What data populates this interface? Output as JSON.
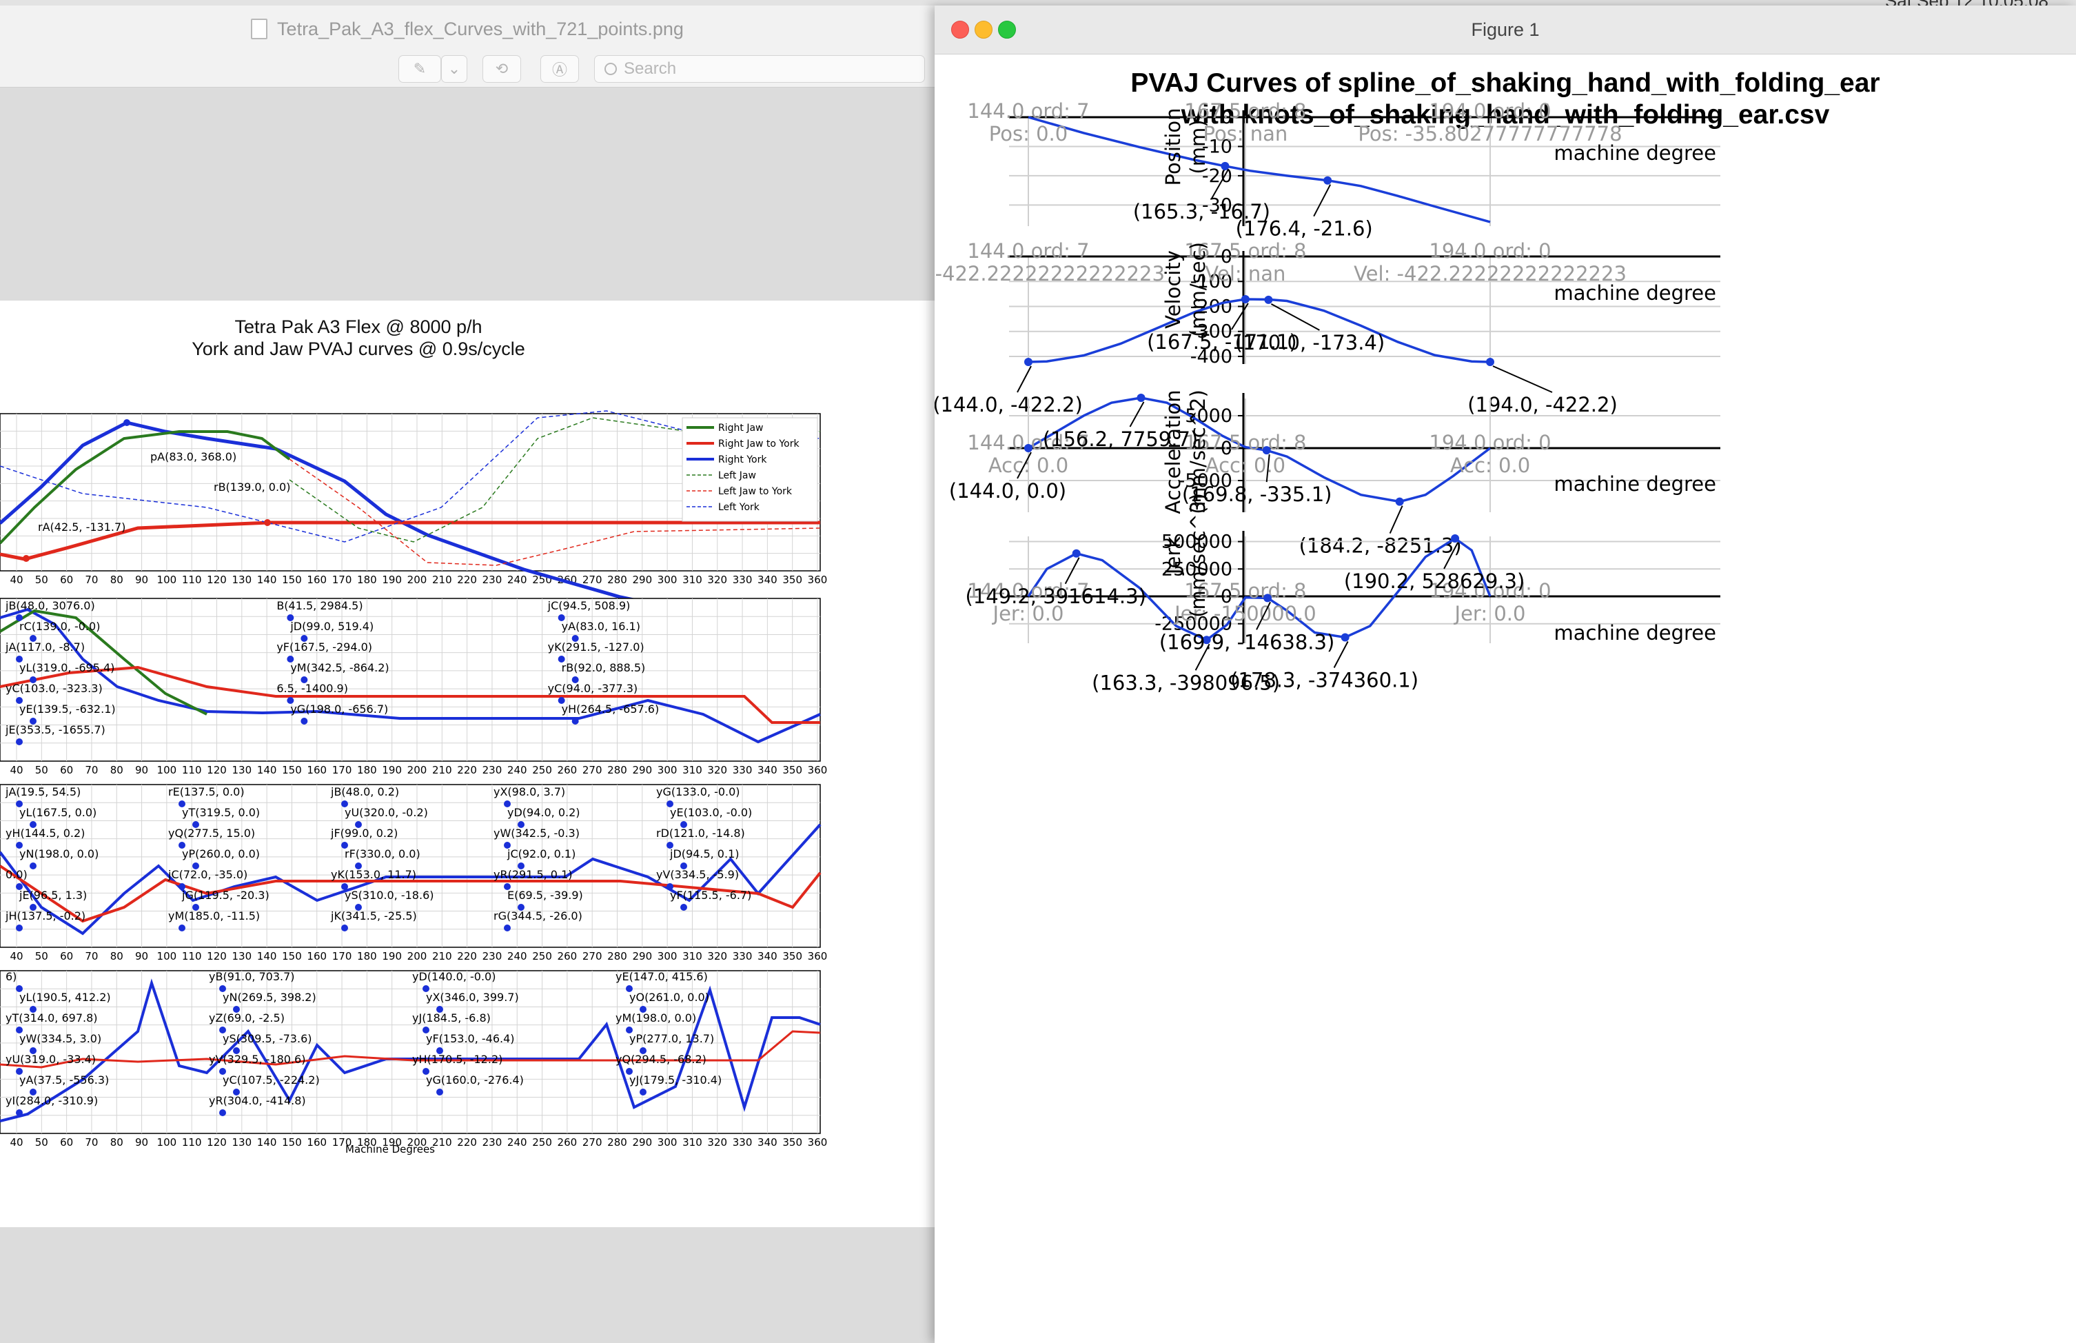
{
  "menubar": {
    "clock": "Sat Sep 12 10:05:08"
  },
  "preview": {
    "window_title": "Tetra_Pak_A3_flex_Curves_with_721_points.png",
    "search_placeholder": "Search",
    "page": {
      "title_line1": "Tetra Pak A3 Flex @ 8000 p/h",
      "title_line2": "York and Jaw PVAJ curves @ 0.9s/cycle",
      "legend": [
        "Right Jaw",
        "Right Jaw to York",
        "Right York",
        "Left Jaw",
        "Left Jaw to York",
        "Left York"
      ],
      "x_ticks": [
        "40",
        "50",
        "60",
        "70",
        "80",
        "90",
        "100",
        "110",
        "120",
        "130",
        "140",
        "150",
        "160",
        "170",
        "180",
        "190",
        "200",
        "210",
        "220",
        "230",
        "240",
        "250",
        "260",
        "270",
        "280",
        "290",
        "300",
        "310",
        "320",
        "330",
        "340",
        "350",
        "360"
      ],
      "x_label": "Machine Degrees",
      "panel1_labels": [
        "pA(83.0, 368.0)",
        "rB(139.0, 0.0)",
        "rA(42.5, -131.7)"
      ],
      "panel2_labels": [
        "jB(48.0, 3076.0)",
        "B(41.5, 2984.5)",
        "jC(94.5, 508.9)",
        "rC(139.0, -0.0)",
        "jD(99.0, 519.4)",
        "yA(83.0, 16.1)",
        "jA(117.0, -8.7)",
        "yF(167.5, -294.0)",
        "yK(291.5, -127.0)",
        "yL(319.0, -695.4)",
        "yM(342.5, -864.2)",
        "rB(92.0, 888.5)",
        "yC(103.0, -323.3)",
        "6.5, -1400.9)",
        "yC(94.0, -377.3)",
        "yE(139.5, -632.1)",
        "yG(198.0, -656.7)",
        "yH(264.5, -657.6)",
        "jE(353.5, -1655.7)"
      ],
      "panel3_labels": [
        "jA(19.5, 54.5)",
        "rE(137.5, 0.0)",
        "jB(48.0, 0.2)",
        "yX(98.0, 3.7)",
        "yG(133.0, -0.0)",
        "yL(167.5, 0.0)",
        "yT(319.5, 0.0)",
        "yU(320.0, -0.2)",
        "yD(94.0, 0.2)",
        "yE(103.0, -0.0)",
        "yH(144.5, 0.2)",
        "yQ(277.5, 15.0)",
        "jF(99.0, 0.2)",
        "yW(342.5, -0.3)",
        "rD(121.0, -14.8)",
        "yN(198.0, 0.0)",
        "yP(260.0, 0.0)",
        "rF(330.0, 0.0)",
        "jC(92.0, 0.1)",
        "jD(94.5, 0.1)",
        "0.0)",
        "jC(72.0, -35.0)",
        "yK(153.0, 11.7)",
        "yR(291.5, 0.1)",
        "yV(334.5, -5.9)",
        "jE(96.5, 1.3)",
        "jG(119.5, -20.3)",
        "yS(310.0, -18.6)",
        "E(69.5, -39.9)",
        "yF(115.5, -6.7)",
        "jH(137.5, -0.2)",
        "yM(185.0, -11.5)",
        "jK(341.5, -25.5)",
        "rG(344.5, -26.0)"
      ],
      "panel4_labels": [
        "6)",
        "yB(91.0, 703.7)",
        "yD(140.0, -0.0)",
        "yE(147.0, 415.6)",
        "yL(190.5, 412.2)",
        "yN(269.5, 398.2)",
        "yX(346.0, 399.7)",
        "yO(261.0, 0.0)",
        "yT(314.0, 697.8)",
        "yZ(69.0, -2.5)",
        "yJ(184.5, -6.8)",
        "yM(198.0, 0.0)",
        "yW(334.5, 3.0)",
        "yS(309.5, -73.6)",
        "yF(153.0, -46.4)",
        "yP(277.0, 13.7)",
        "yU(319.0, -33.4)",
        "yV(329.5, -180.6)",
        "yH(170.5, -12.2)",
        "yQ(294.5, -68.2)",
        "yA(37.5, -556.3)",
        "yC(107.5, -224.2)",
        "yG(160.0, -276.4)",
        "yJ(179.5, -310.4)",
        "yI(284.0, -310.9)",
        "yR(304.0, -414.8)"
      ]
    }
  },
  "figure": {
    "window_title": "Figure 1",
    "title_line1": "PVAJ Curves of spline_of_shaking_hand_with_folding_ear",
    "title_line2": "with knots_of_shaking_hand_with_folding_ear.csv",
    "x_label": "machine degree",
    "knot_labels": [
      {
        "ord": "144.0 ord: 7",
        "pos": "Pos: 0.0",
        "vel": "Vel: -422.22222222222223",
        "acc": "Acc: 0.0",
        "jer": "Jer: 0.0"
      },
      {
        "ord": "167.5 ord: 8",
        "pos": "Pos: nan",
        "vel": "Vel: nan",
        "acc": "Acc: 0.0",
        "jer": "Jer: -150000.0"
      },
      {
        "ord": "194.0 ord: 0",
        "pos": "Pos: -35.80277777777778",
        "vel": "Vel: -422.22222222222223",
        "acc": "Acc: 0.0",
        "jer": "Jer: 0.0"
      }
    ],
    "chart_data": [
      {
        "type": "line",
        "ylabel": "Position (mm)",
        "xlim": [
          140,
          199
        ],
        "ylim": [
          -38,
          1
        ],
        "yticks": [
          0,
          -10,
          -20,
          -30
        ],
        "x": [
          144,
          150,
          156,
          162,
          165.3,
          168,
          172,
          176.4,
          180,
          184,
          188,
          194
        ],
        "y": [
          0,
          -5.4,
          -10.2,
          -14.6,
          -16.7,
          -18.3,
          -20.0,
          -21.6,
          -23.5,
          -26.9,
          -30.5,
          -35.8
        ],
        "annotations": [
          {
            "x": 165.3,
            "y": -16.7,
            "text": "(165.3, -16.7)"
          },
          {
            "x": 176.4,
            "y": -21.6,
            "text": "(176.4, -21.6)"
          }
        ]
      },
      {
        "type": "line",
        "ylabel": "Velocity (mm/sec)",
        "xlim": [
          140,
          199
        ],
        "ylim": [
          -470,
          5
        ],
        "yticks": [
          0,
          -100,
          -200,
          -300,
          -400
        ],
        "x": [
          144,
          146,
          150,
          154,
          158,
          162,
          165,
          167.5,
          170,
          172,
          176,
          180,
          184,
          188,
          192,
          194
        ],
        "y": [
          -422.2,
          -420,
          -396,
          -349,
          -286,
          -223,
          -186,
          -171,
          -172,
          -178,
          -217,
          -277,
          -342,
          -395,
          -420,
          -422.2
        ],
        "annotations": [
          {
            "x": 144.0,
            "y": -422.2,
            "text": "(144.0, -422.2)"
          },
          {
            "x": 167.5,
            "y": -171,
            "text": "(167.5, -171.1)"
          },
          {
            "x": 170.0,
            "y": -173.4,
            "text": "(170.0, -173.4)"
          },
          {
            "x": 194.0,
            "y": -422.2,
            "text": "(194.0, -422.2)"
          }
        ]
      },
      {
        "type": "line",
        "ylabel": "Acceleration (mm/sec^2)",
        "xlim": [
          140,
          199
        ],
        "ylim": [
          -9000,
          9000
        ],
        "yticks": [
          5000,
          0,
          -5000
        ],
        "x": [
          144,
          147,
          150,
          153,
          156.2,
          159,
          162,
          165,
          167.5,
          169.8,
          172,
          176,
          180,
          184.2,
          187,
          190,
          194
        ],
        "y": [
          0,
          2500,
          5000,
          7000,
          7759.7,
          7000,
          4600,
          1900,
          150,
          -335.1,
          -1300,
          -4500,
          -7200,
          -8251.3,
          -7200,
          -4300,
          0
        ],
        "annotations": [
          {
            "x": 144.0,
            "y": 0.0,
            "text": "(144.0, 0.0)"
          },
          {
            "x": 156.2,
            "y": 7759.7,
            "text": "(156.2, 7759.7)"
          },
          {
            "x": 169.8,
            "y": -335.1,
            "text": "(169.8, -335.1)"
          },
          {
            "x": 184.2,
            "y": -8251.3,
            "text": "(184.2, -8251.3)"
          }
        ]
      },
      {
        "type": "line",
        "ylabel": "Jerk (mm/sec^3)",
        "xlim": [
          140,
          199
        ],
        "ylim": [
          -470000,
          650000
        ],
        "yticks": [
          500000,
          250000,
          0,
          -250000
        ],
        "x": [
          144,
          146,
          149.2,
          152,
          156,
          160,
          163.3,
          165.5,
          167.5,
          169.9,
          172,
          175,
          178.3,
          181,
          184,
          187,
          190.2,
          192,
          194
        ],
        "y": [
          0,
          250000,
          391614.3,
          330000,
          80000,
          -270000,
          -398096.5,
          -260000,
          -10000,
          -14638.3,
          -130000,
          -330000,
          -374360.1,
          -270000,
          40000,
          360000,
          528629.3,
          420000,
          0
        ],
        "annotations": [
          {
            "x": 149.2,
            "y": 391614.3,
            "text": "(149.2, 391614.3)"
          },
          {
            "x": 163.3,
            "y": -398096.5,
            "text": "(163.3, -398096.5)"
          },
          {
            "x": 169.9,
            "y": -14638.3,
            "text": "(169.9, -14638.3)"
          },
          {
            "x": 178.3,
            "y": -374360.1,
            "text": "(178.3, -374360.1)"
          },
          {
            "x": 190.2,
            "y": 528629.3,
            "text": "(190.2, 528629.3)"
          }
        ]
      }
    ]
  },
  "colors": {
    "curve": "#1a3ed8",
    "green": "#2a7a1e",
    "red": "#e0281c",
    "blue": "#1a2fd8",
    "grid": "#cfcfcf",
    "axis": "#000000",
    "knot_text": "#9a9a9a"
  }
}
